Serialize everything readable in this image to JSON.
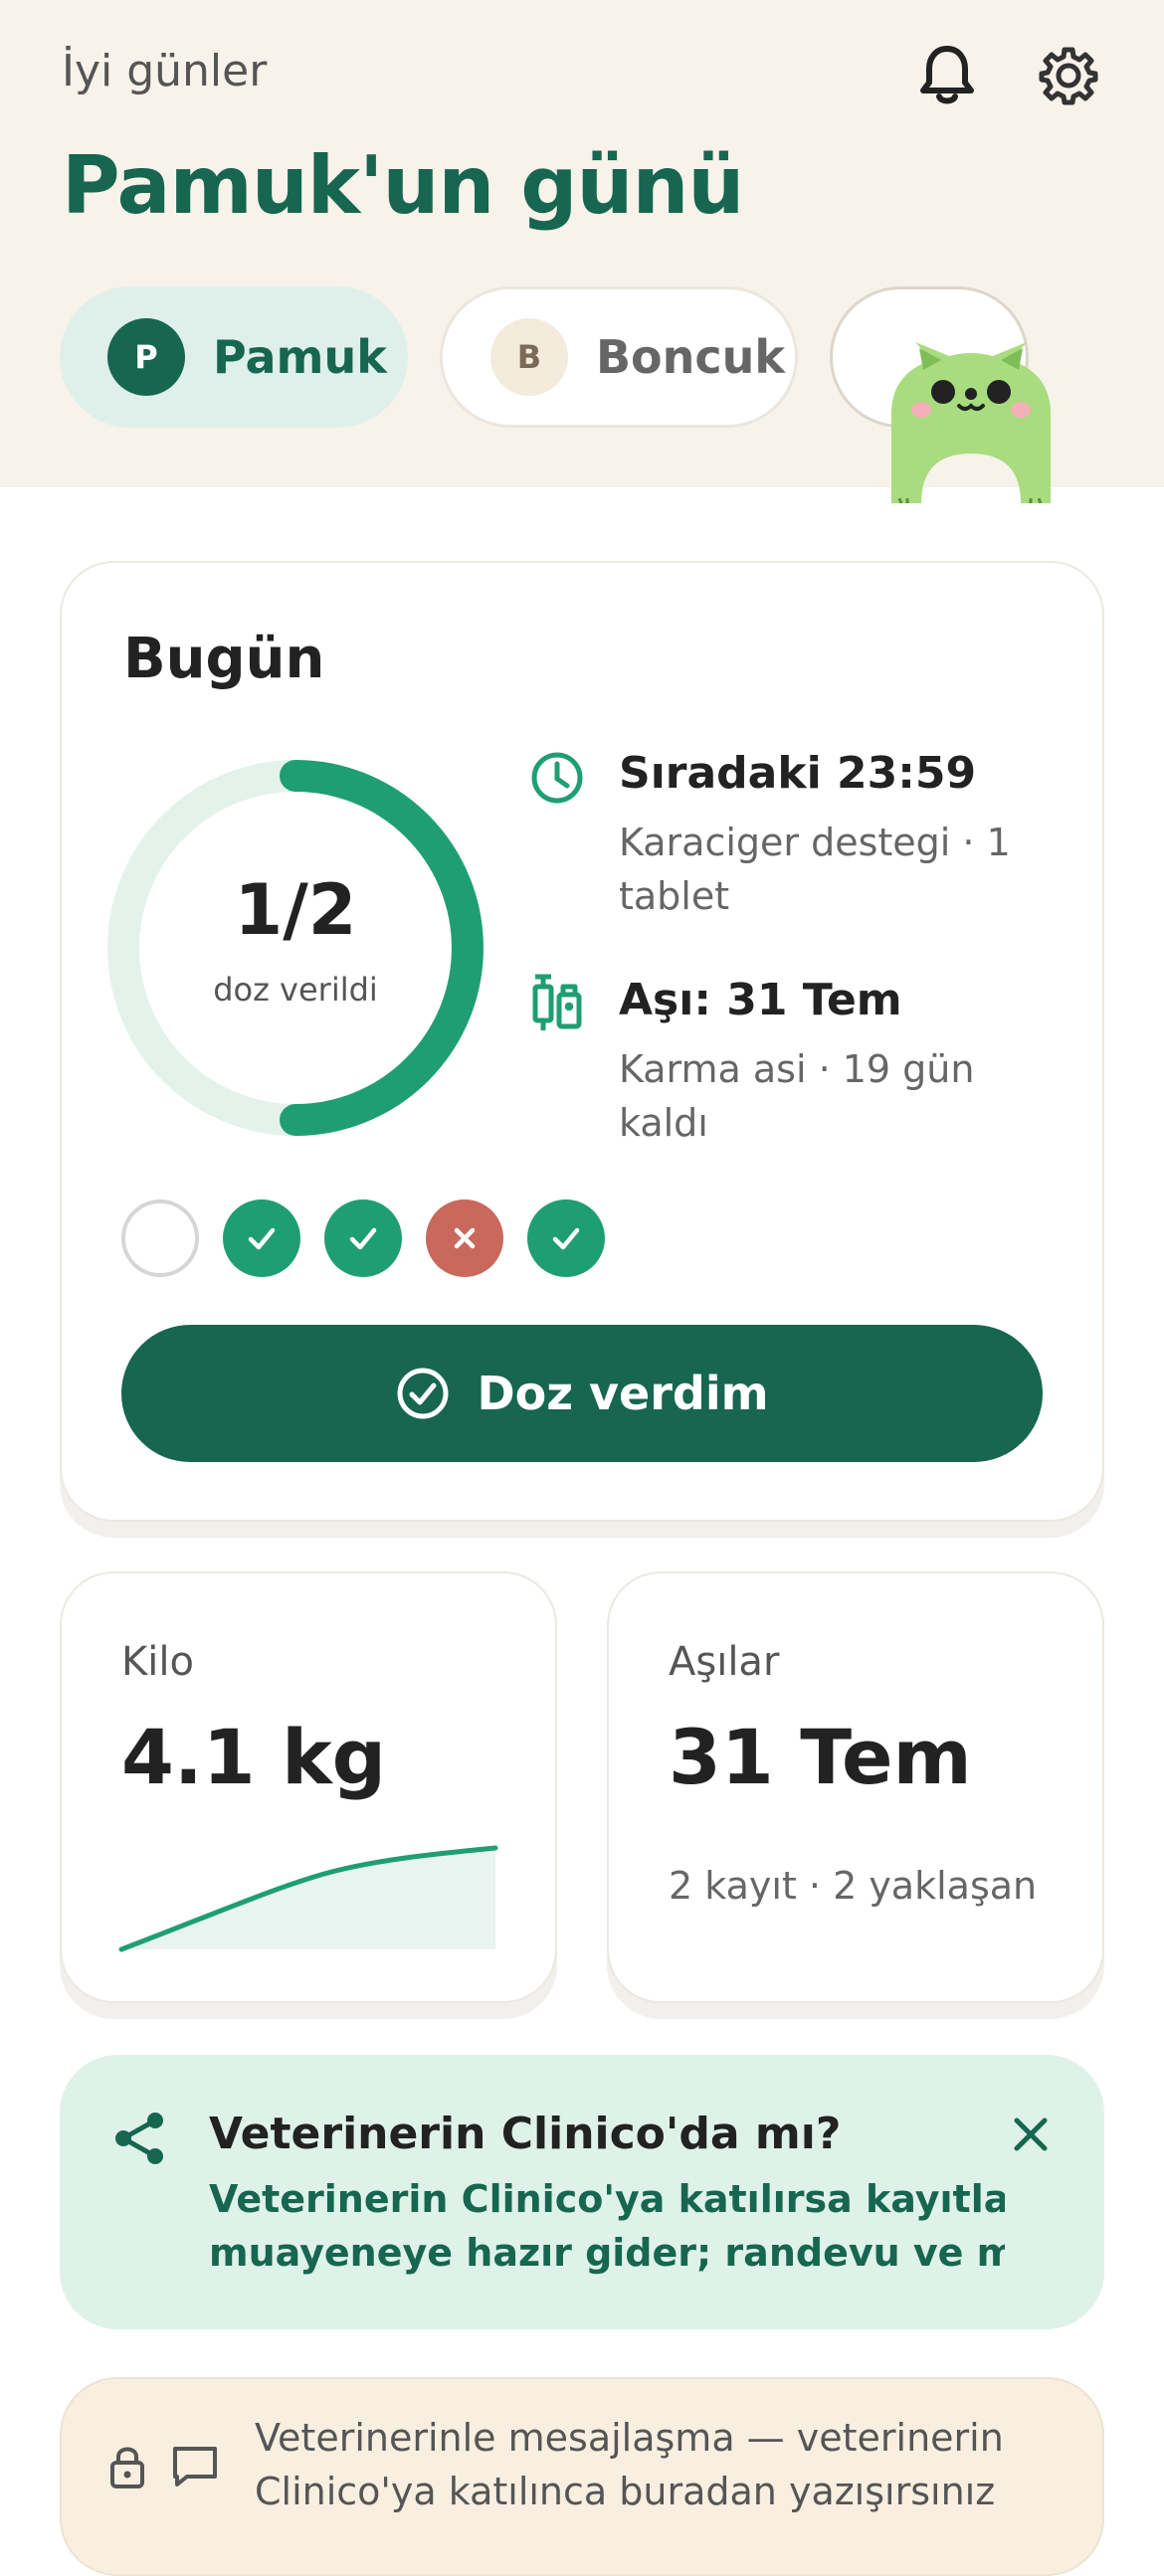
{
  "header": {
    "greeting": "İyi günler",
    "title": "Pamuk'un günü",
    "icons": [
      "bell-icon",
      "gear-icon"
    ]
  },
  "pets": [
    {
      "initial": "P",
      "name": "Pamuk",
      "active": true
    },
    {
      "initial": "B",
      "name": "Boncuk",
      "active": false
    }
  ],
  "today": {
    "title": "Bugün",
    "progress": {
      "given": 1,
      "total": 2,
      "label": "1/2",
      "sub": "doz verildi"
    },
    "next": {
      "title": "Sıradaki 23:59",
      "detail": "Karaciger destegi · 1 tablet",
      "icon": "clock-icon"
    },
    "vaccine": {
      "title": "Aşı: 31 Tem",
      "detail": "Karma asi · 19 gün kaldı",
      "icon": "syringe-icon"
    },
    "history": [
      "pending",
      "done",
      "done",
      "missed",
      "done"
    ],
    "cta_label": "Doz verdim"
  },
  "weight": {
    "label": "Kilo",
    "value": "4.1 kg"
  },
  "vaccines": {
    "label": "Aşılar",
    "value": "31 Tem",
    "sub": "2 kayıt · 2 yaklaşan"
  },
  "clinic_banner": {
    "title": "Veterinerin Clinico'da mı?",
    "line1": "Veterinerin Clinico'ya katılırsa kayıtların",
    "line2": "muayeneye hazır gider; randevu ve mes..."
  },
  "message_note": {
    "text": "Veterinerinle mesajlaşma — veterinerin Clinico'ya katılınca buradan yazışırsınız"
  },
  "colors": {
    "primary": "#17664f",
    "accent": "#1f9e74",
    "danger": "#c9685c",
    "hero_bg": "#f7f2ea",
    "banner_bg": "#dff2ea"
  }
}
